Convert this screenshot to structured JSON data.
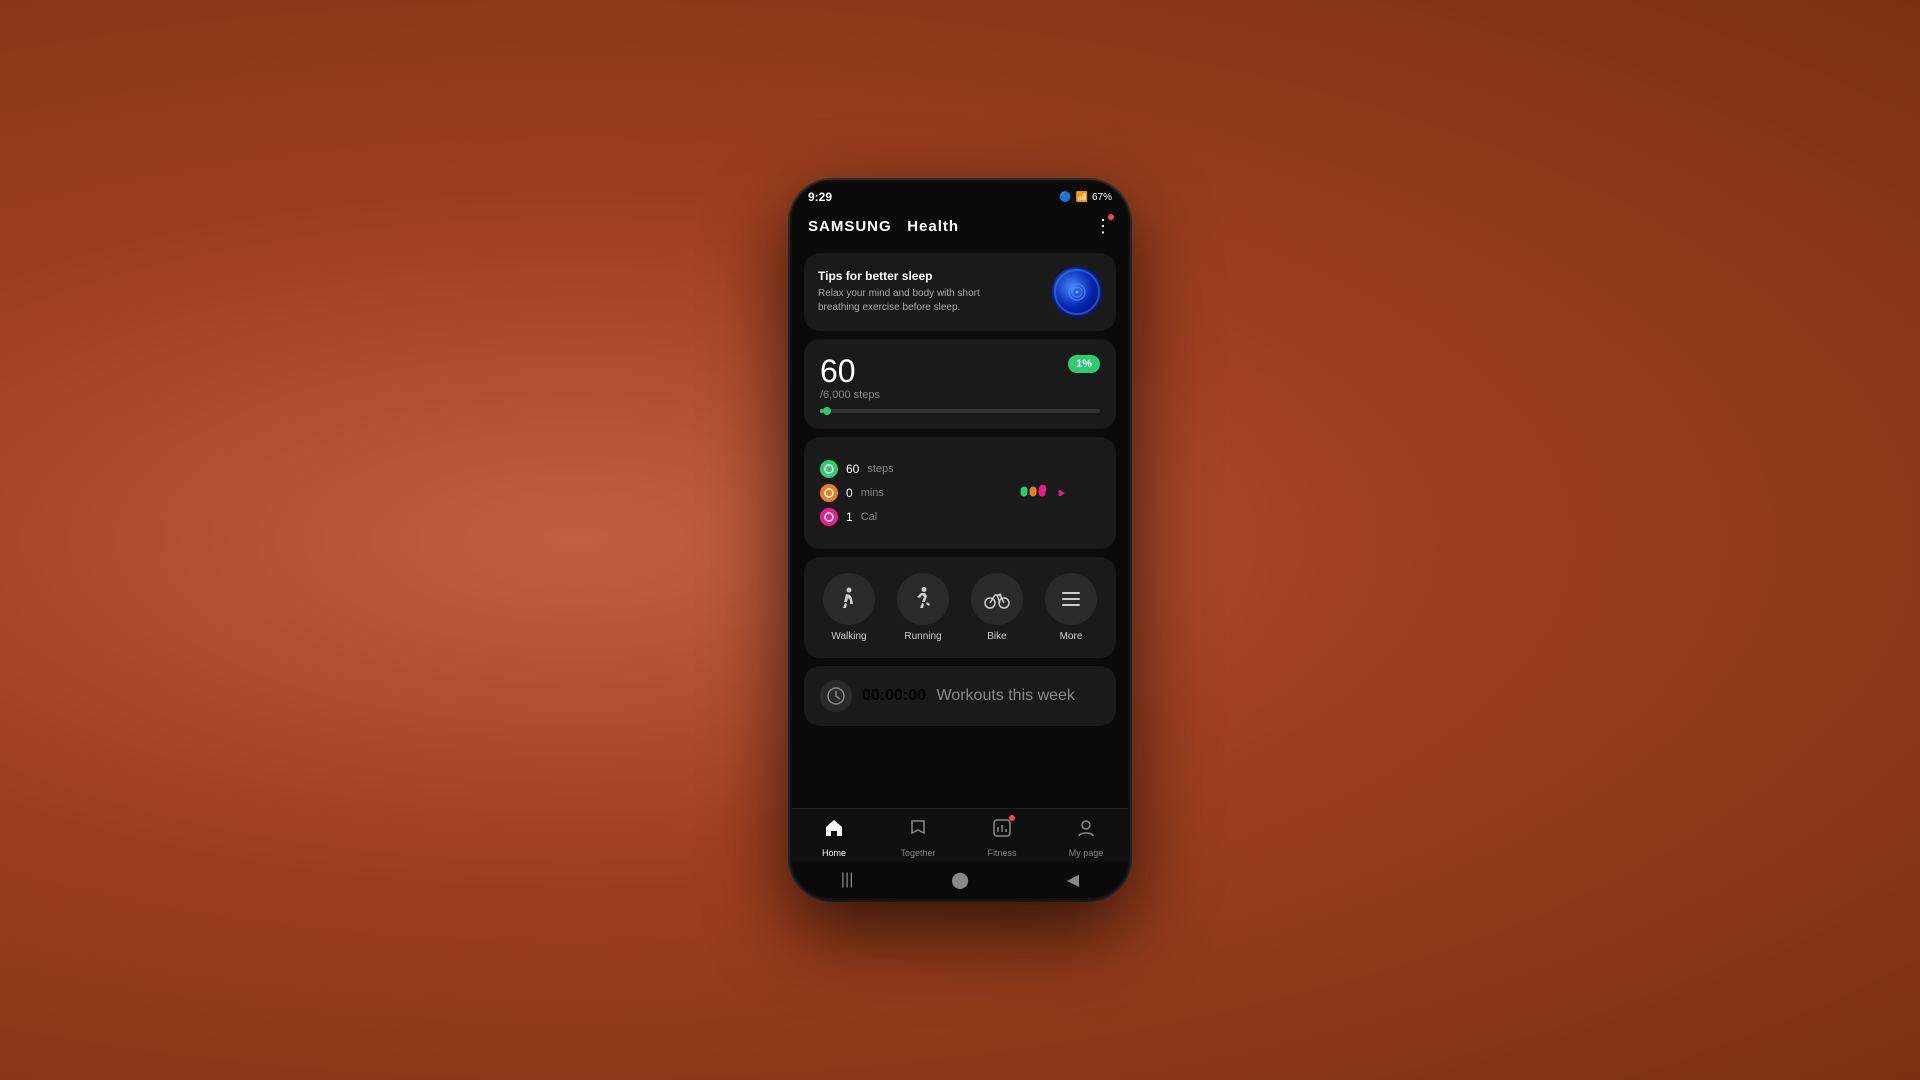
{
  "background": {
    "color": "#b05030"
  },
  "status_bar": {
    "time": "9:29",
    "battery": "67%",
    "icons": "🔵 📶 🔒 ⏰"
  },
  "app_header": {
    "title_brand": "SAMSUNG",
    "title_app": "Health",
    "menu_icon": "⋮"
  },
  "sleep_card": {
    "title": "Tips for better sleep",
    "description": "Relax your mind and body with short breathing exercise before sleep."
  },
  "steps": {
    "count": "60",
    "goal": "/6,000 steps",
    "percent": "1%",
    "progress": 1
  },
  "activity": {
    "steps_value": "60",
    "steps_unit": "steps",
    "mins_value": "0",
    "mins_unit": "mins",
    "cal_value": "1",
    "cal_unit": "Cal"
  },
  "quick_actions": [
    {
      "label": "Walking",
      "icon": "🚶"
    },
    {
      "label": "Running",
      "icon": "🏃"
    },
    {
      "label": "Bike",
      "icon": "🚲"
    },
    {
      "label": "More",
      "icon": "☰"
    }
  ],
  "workout": {
    "time": "00:00:00",
    "label": "Workouts this week"
  },
  "bottom_nav": [
    {
      "label": "Home",
      "icon": "🏠",
      "active": true
    },
    {
      "label": "Together",
      "icon": "🚩",
      "active": false
    },
    {
      "label": "Fitness",
      "icon": "📊",
      "active": false,
      "badge": true
    },
    {
      "label": "My page",
      "icon": "👤",
      "active": false
    }
  ],
  "android_nav": {
    "back": "◀",
    "home": "⬤",
    "recent": "|||"
  }
}
